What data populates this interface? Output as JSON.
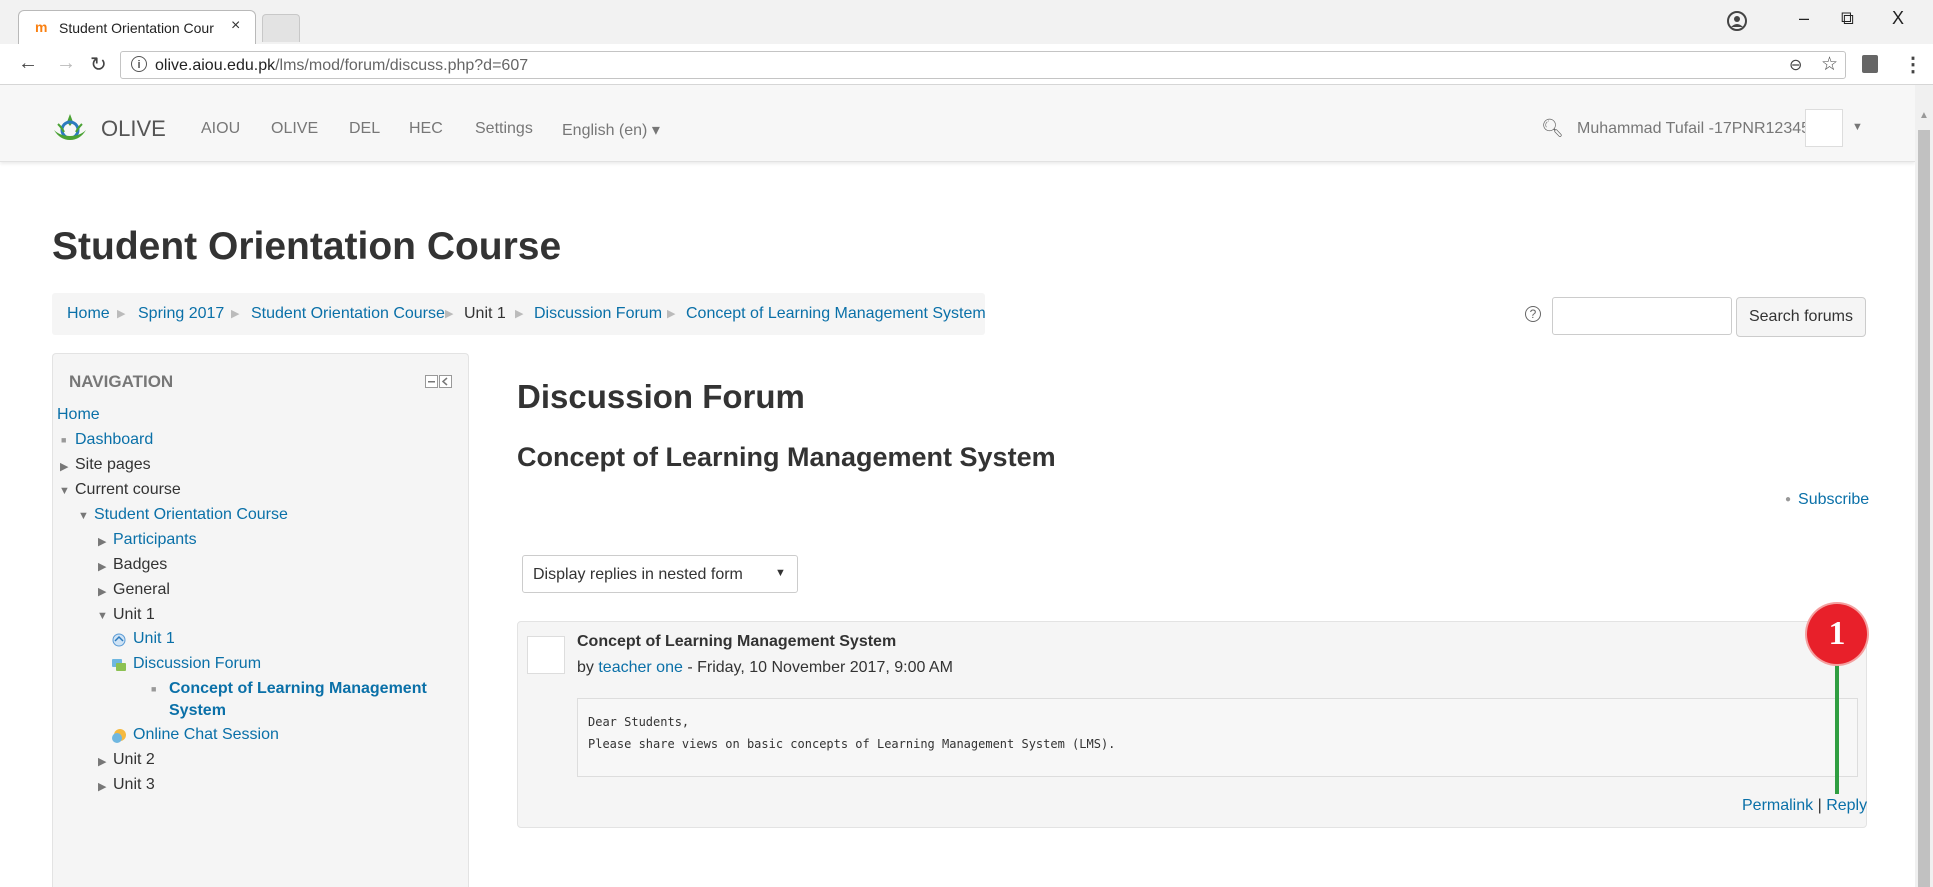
{
  "browser": {
    "tab_title": "Student Orientation Cour",
    "tab_close": "×",
    "url_host": "olive.aiou.edu.pk",
    "url_path": "/lms/mod/forum/discuss.php?d=607",
    "window_controls": {
      "minimize": "–",
      "restore": "⧉",
      "close": "X"
    },
    "icons": [
      "back-arrow",
      "forward-arrow",
      "reload",
      "info",
      "zoom",
      "star",
      "extension",
      "menu"
    ]
  },
  "navbar": {
    "brand": "OLIVE",
    "menu": [
      "AIOU",
      "OLIVE",
      "DEL",
      "HEC",
      "Settings",
      "English (en) ▾"
    ],
    "user_name": "Muhammad Tufail -17PNR12345",
    "brand_color": "#4aa233"
  },
  "page": {
    "course_title": "Student Orientation Course",
    "breadcrumb": [
      "Home",
      "Spring 2017",
      "Student Orientation Course",
      "Unit 1",
      "Discussion Forum",
      "Concept of Learning Management System"
    ],
    "search_button": "Search forums",
    "search_placeholder": ""
  },
  "navigation": {
    "heading": "NAVIGATION",
    "items": {
      "home": "Home",
      "dashboard": "Dashboard",
      "site_pages": "Site pages",
      "current_course": "Current course",
      "course": "Student Orientation Course",
      "participants": "Participants",
      "badges": "Badges",
      "general": "General",
      "unit1": "Unit 1",
      "unit1_page": "Unit 1",
      "discussion_forum": "Discussion Forum",
      "concept_line1": "Concept of Learning Management",
      "concept_line2": "System",
      "online_chat": "Online Chat Session",
      "unit2": "Unit 2",
      "unit3": "Unit 3"
    }
  },
  "forum": {
    "heading": "Discussion Forum",
    "discussion_title": "Concept of Learning Management System",
    "subscribe": "Subscribe",
    "display_mode": "Display replies in nested form",
    "post": {
      "subject": "Concept of Learning Management System",
      "by_prefix": "by",
      "author": "teacher one",
      "date": " - Friday, 10 November 2017, 9:00 AM",
      "body_lines": [
        "Dear Students,",
        "Please share views on basic concepts of Learning Management System (LMS)."
      ],
      "permalink": "Permalink",
      "separator": "|",
      "reply": "Reply"
    }
  },
  "annotation": {
    "label": "1",
    "color": "#e8202a",
    "line_color": "#2f9e41"
  },
  "colors": {
    "link": "#0a70a8",
    "text": "#333333",
    "block_bg": "#f5f5f5"
  }
}
